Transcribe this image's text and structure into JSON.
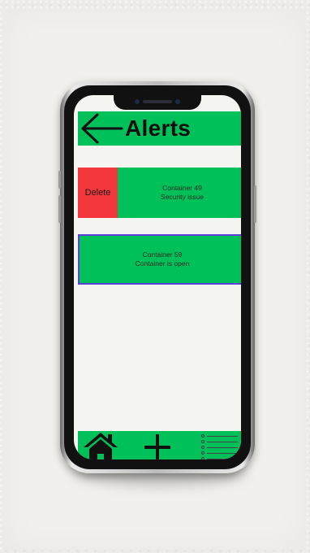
{
  "header": {
    "title": "Alerts",
    "back_icon": "arrow-left-icon"
  },
  "alerts": [
    {
      "line1": "Container 49",
      "line2": "Security issue",
      "delete_label": "Delete"
    },
    {
      "line1": "Container 59",
      "line2": "Container is open"
    }
  ],
  "nav": {
    "items": [
      "home-icon",
      "plus-icon",
      "list-icon"
    ]
  },
  "colors": {
    "accent": "#00c05a",
    "delete": "#f2363b",
    "selected_border": "#5b3fd6",
    "screen_bg": "#f4f4f1"
  }
}
